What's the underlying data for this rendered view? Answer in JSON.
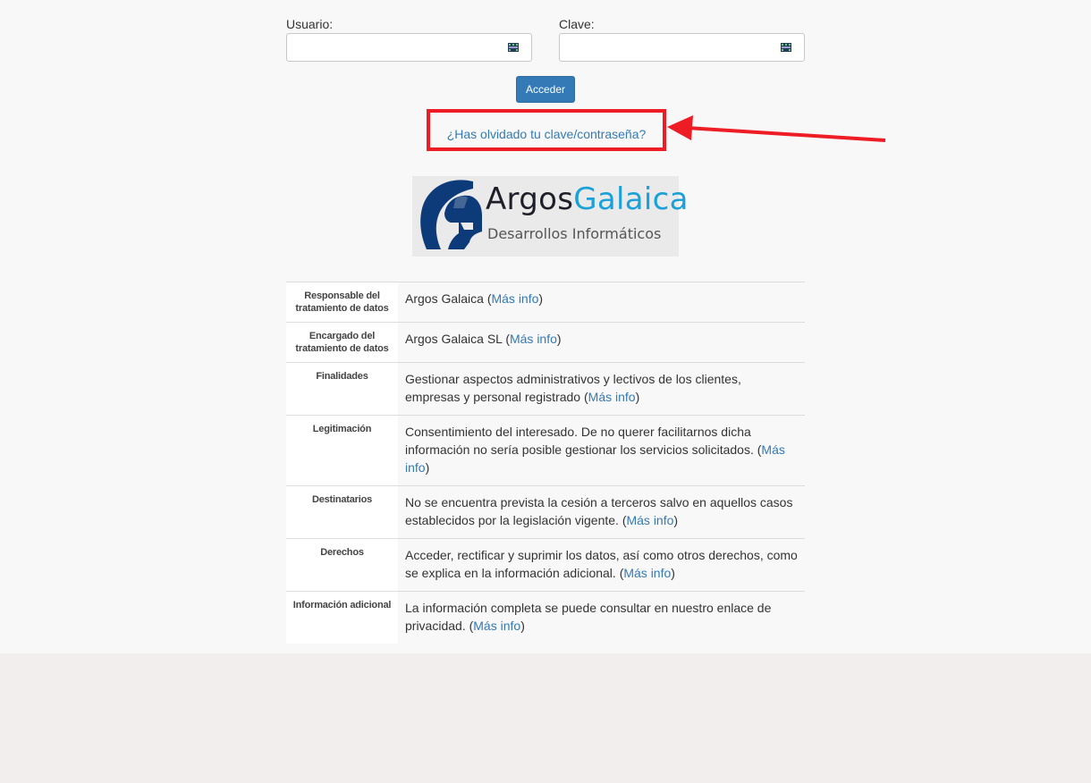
{
  "login": {
    "user_label": "Usuario:",
    "user_value": "",
    "pass_label": "Clave:",
    "pass_value": "",
    "submit_label": "Acceder",
    "forgot_link": "¿Has olvidado tu clave/contraseña?"
  },
  "logo": {
    "name_part1": "Argos",
    "name_part2": "Galaica",
    "tagline": "Desarrollos Informáticos"
  },
  "privacy": {
    "more_info": "Más info",
    "rows": [
      {
        "key": "Responsable del tratamiento de datos",
        "text": "Argos Galaica ("
      },
      {
        "key": "Encargado del tratamiento de datos",
        "text": "Argos Galaica SL ("
      },
      {
        "key": "Finalidades",
        "text": "Gestionar aspectos administrativos y lectivos de los clientes, empresas y personal registrado ("
      },
      {
        "key": "Legitimación",
        "text": "Consentimiento del interesado. De no querer facilitarnos dicha información no sería posible gestionar los servicios solicitados. ("
      },
      {
        "key": "Destinatarios",
        "text": "No se encuentra prevista la cesión a terceros salvo en aquellos casos establecidos por la legislación vigente. ("
      },
      {
        "key": "Derechos",
        "text": "Acceder, rectificar y suprimir los datos, así como otros derechos, como se explica en la información adicional. ("
      },
      {
        "key": "Información adicional",
        "text": "La información completa se puede consultar en nuestro enlace de privacidad. ("
      }
    ]
  },
  "colors": {
    "primary": "#337ab7",
    "highlight": "#ee1c24",
    "brand_blue": "#1aa1d9",
    "helmet": "#0d3b7a"
  }
}
